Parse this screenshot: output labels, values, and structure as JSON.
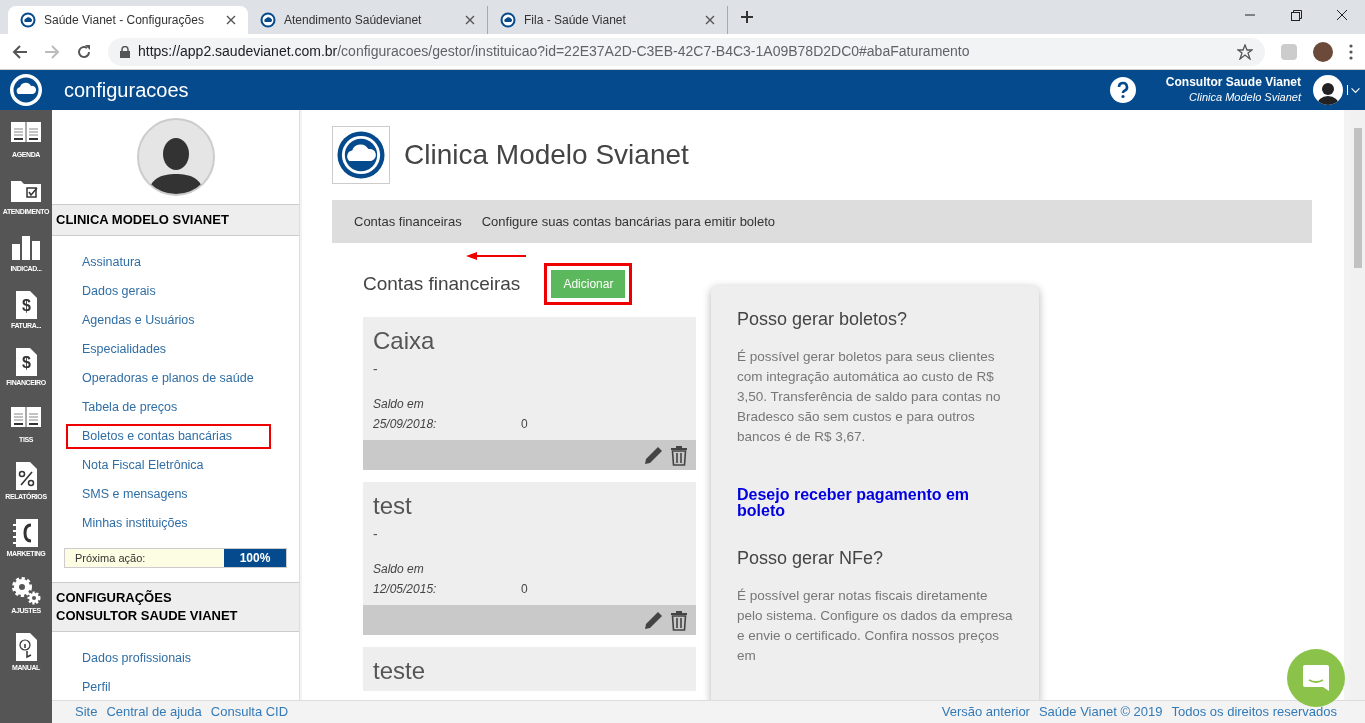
{
  "browser": {
    "tabs": [
      {
        "title": "Saúde Vianet - Configurações",
        "selected": true
      },
      {
        "title": "Atendimento Saúdevianet",
        "selected": false
      },
      {
        "title": "Fila - Saúde Vianet",
        "selected": false
      }
    ],
    "url_host": "https://app2.saudevianet.com.br",
    "url_path": "/configuracoes/gestor/instituicao?id=22E37A2D-C3EB-42C7-B4C3-1A09B78D2DC0#abaFaturamento"
  },
  "header": {
    "title": "configuracoes",
    "user_name": "Consultor Saude Vianet",
    "user_org": "Clinica Modelo Svianet"
  },
  "rail": [
    {
      "label": "AGENDA"
    },
    {
      "label": "ATENDIMENTO"
    },
    {
      "label": "INDICAD..."
    },
    {
      "label": "FATURA...",
      "glyph": "$"
    },
    {
      "label": "FINANCEIRO",
      "glyph": "$"
    },
    {
      "label": "TISS"
    },
    {
      "label": "RELATÓRIOS"
    },
    {
      "label": "MARKETING"
    },
    {
      "label": "AJUSTES"
    },
    {
      "label": "MANUAL"
    }
  ],
  "sidebar": {
    "sections": [
      {
        "title": "CLINICA MODELO SVIANET",
        "items": [
          {
            "label": "Assinatura",
            "highlighted": false
          },
          {
            "label": "Dados gerais",
            "highlighted": false
          },
          {
            "label": "Agendas e Usuários",
            "highlighted": false
          },
          {
            "label": "Especialidades",
            "highlighted": false
          },
          {
            "label": "Operadoras e planos de saúde",
            "highlighted": false
          },
          {
            "label": "Tabela de preços",
            "highlighted": false
          },
          {
            "label": "Boletos e contas bancárias",
            "highlighted": true
          },
          {
            "label": "Nota Fiscal Eletrônica",
            "highlighted": false
          },
          {
            "label": "SMS e mensagens",
            "highlighted": false
          },
          {
            "label": "Minhas instituições",
            "highlighted": false
          }
        ],
        "progress": {
          "label": "Próxima ação:",
          "reading": "100%",
          "level": 1
        }
      },
      {
        "title": "CONFIGURAÇÕES\nCONSULTOR SAUDE VIANET",
        "items": [
          {
            "label": "Dados profissionais",
            "highlighted": false
          },
          {
            "label": "Perfil",
            "highlighted": false
          }
        ]
      }
    ]
  },
  "main": {
    "title": "Clinica Modelo Svianet",
    "breadcrumb": [
      "Contas financeiras",
      "Configure suas contas bancárias para emitir boleto"
    ],
    "section_title": "Contas financeiras",
    "add_button": {
      "label": "Adicionar",
      "highlighted": true
    },
    "accounts": [
      {
        "name": "Caixa",
        "subtitle": "-",
        "balance_label": "Saldo em",
        "balance_date": "25/09/2018:",
        "balance": "0"
      },
      {
        "name": "test",
        "subtitle": "-",
        "balance_label": "Saldo em",
        "balance_date": "12/05/2015:",
        "balance": "0"
      },
      {
        "name": "teste"
      }
    ],
    "info": [
      {
        "kind": "heading",
        "text": "Posso gerar boletos?"
      },
      {
        "kind": "paragraph",
        "text": "É possível gerar boletos para seus clientes com integração automática ao custo de R$ 3,50. Transferência de saldo para contas no Bradesco são sem custos e para outros bancos é de R$ 3,67."
      },
      {
        "kind": "link",
        "text": "Desejo receber pagamento em boleto"
      },
      {
        "kind": "heading",
        "text": "Posso gerar NFe?"
      },
      {
        "kind": "paragraph",
        "text": "É possível gerar notas fiscais diretamente pelo sistema. Configure os dados da empresa e envie o certificado. Confira nossos preços em"
      }
    ]
  },
  "footer": {
    "left": [
      "Site",
      "Central de ajuda",
      "Consulta CID"
    ],
    "right": [
      "Versão anterior",
      "Saúde Vianet © 2019",
      "Todos os direitos reservados"
    ]
  }
}
